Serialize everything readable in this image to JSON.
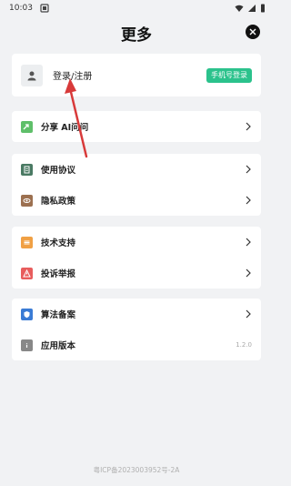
{
  "status": {
    "time": "10:03"
  },
  "header": {
    "title": "更多"
  },
  "login": {
    "text": "登录/注册",
    "button": "手机号登录"
  },
  "sections": {
    "share": {
      "label": "分享 AI问问"
    },
    "agreement": {
      "label": "使用协议"
    },
    "privacy": {
      "label": "隐私政策"
    },
    "support": {
      "label": "技术支持"
    },
    "complaint": {
      "label": "投诉举报"
    },
    "algorithm": {
      "label": "算法备案"
    },
    "version": {
      "label": "应用版本",
      "value": "1.2.0"
    }
  },
  "footer": {
    "icp": "粤ICP备2023003952号-2A"
  },
  "colors": {
    "accent": "#2bc28c",
    "share_icon": "#5fbf6a",
    "agreement_icon": "#4a7a63",
    "privacy_icon": "#9c7050",
    "support_icon": "#f0a044",
    "complaint_icon": "#e85d5d",
    "algorithm_icon": "#3a7bd5",
    "version_icon": "#888888",
    "annotation_arrow": "#d83a3a"
  }
}
